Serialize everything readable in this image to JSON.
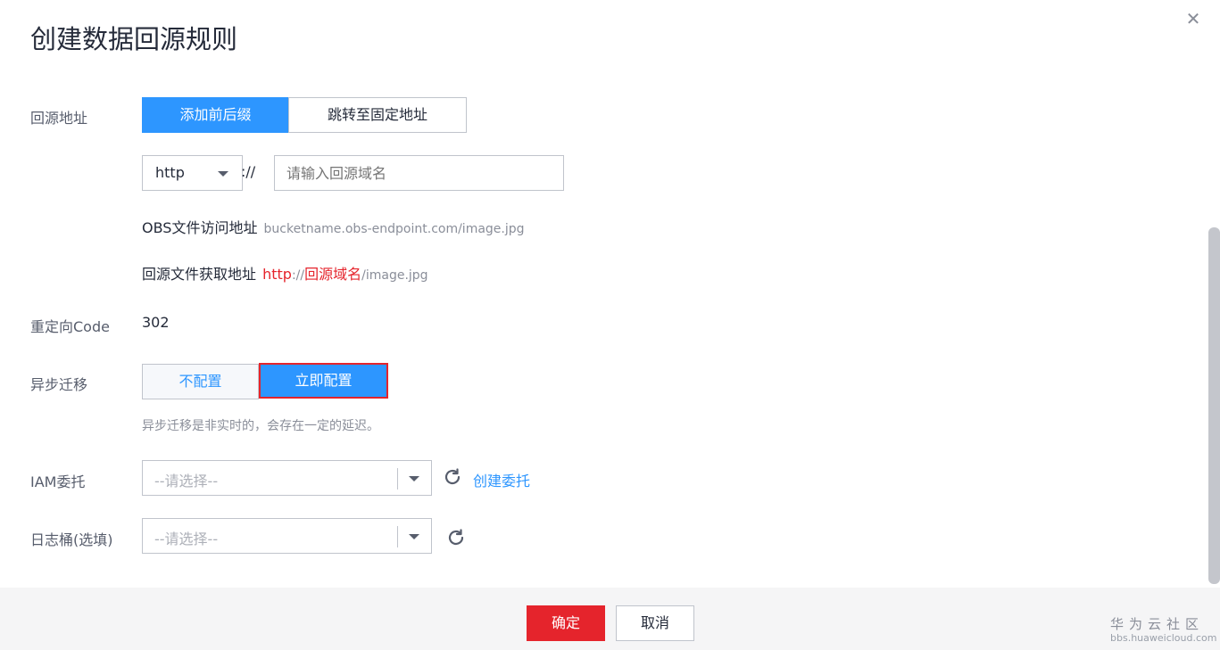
{
  "dialog": {
    "title": "创建数据回源规则",
    "close_icon": "close-icon"
  },
  "source_address": {
    "label": "回源地址",
    "tabs": [
      "添加前后缀",
      "跳转至固定地址"
    ],
    "active_tab": 0,
    "protocol": {
      "selected": "http",
      "separator": "://"
    },
    "domain_input": {
      "value": "",
      "placeholder": "请输入回源域名"
    },
    "obs_label": "OBS文件访问地址",
    "obs_example": "bucketname.obs-endpoint.com/image.jpg",
    "fetch_label": "回源文件获取地址",
    "fetch_protocol": "http",
    "fetch_sep": "://",
    "fetch_domain": "回源域名",
    "fetch_path": "/image.jpg"
  },
  "redirect": {
    "label": "重定向Code",
    "value": "302"
  },
  "async_migration": {
    "label": "异步迁移",
    "options": [
      "不配置",
      "立即配置"
    ],
    "active_option": 1,
    "hint": "异步迁移是非实时的，会存在一定的延迟。"
  },
  "iam": {
    "label": "IAM委托",
    "placeholder": "--请选择--",
    "create_link": "创建委托"
  },
  "log_bucket": {
    "label": "日志桶(选填)",
    "placeholder": "--请选择--"
  },
  "footer": {
    "confirm": "确定",
    "cancel": "取消"
  },
  "watermark": {
    "title": "华为云社区",
    "url": "bbs.huaweicloud.com"
  },
  "colors": {
    "primary": "#2d96ff",
    "danger": "#e5242c",
    "text": "#252b3a"
  }
}
